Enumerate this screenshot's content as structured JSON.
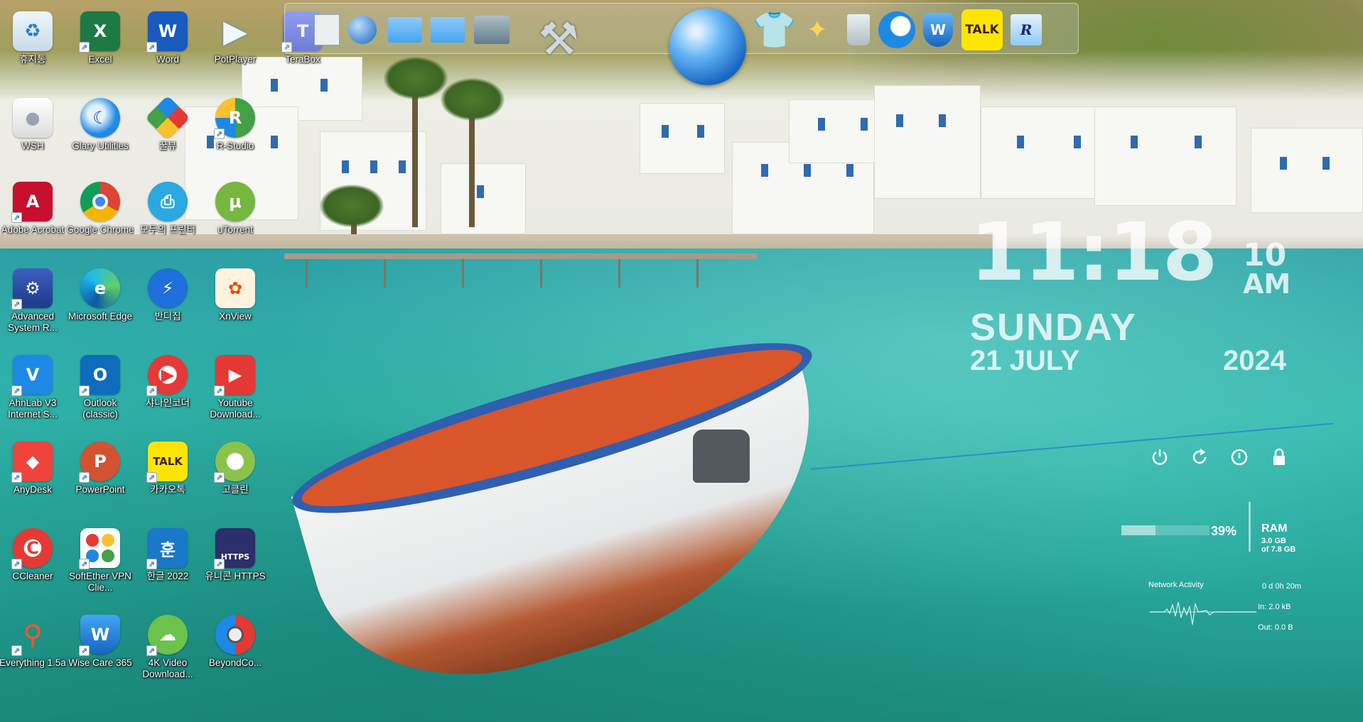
{
  "desktop": {
    "icons": [
      {
        "label": "휴지통"
      },
      {
        "label": "Excel"
      },
      {
        "label": "Word"
      },
      {
        "label": "PotPlayer"
      },
      {
        "label": "TeraBox"
      },
      {
        "label": "WSH"
      },
      {
        "label": "Glary Utilities"
      },
      {
        "label": "꿀뷰"
      },
      {
        "label": "R-Studio"
      },
      {
        "label": "Adobe Acrobat"
      },
      {
        "label": "Google Chrome"
      },
      {
        "label": "모두의 프린터"
      },
      {
        "label": "uTorrent"
      },
      {
        "label": "Advanced System R..."
      },
      {
        "label": "Microsoft Edge"
      },
      {
        "label": "반디집"
      },
      {
        "label": "XnView"
      },
      {
        "label": "AhnLab V3 Internet S..."
      },
      {
        "label": "Outlook (classic)"
      },
      {
        "label": "샤나인코더"
      },
      {
        "label": "Youtube Download..."
      },
      {
        "label": "AnyDesk"
      },
      {
        "label": "PowerPoint"
      },
      {
        "label": "카카오톡"
      },
      {
        "label": "고클린"
      },
      {
        "label": "CCleaner"
      },
      {
        "label": "SoftEther VPN Clie..."
      },
      {
        "label": "한글 2022"
      },
      {
        "label": "유니콘 HTTPS"
      },
      {
        "label": "Everything 1.5a"
      },
      {
        "label": "Wise Care 365"
      },
      {
        "label": "4K Video Download..."
      },
      {
        "label": "BeyondCo..."
      }
    ],
    "icon_glyphs": {
      "excel": "X",
      "word": "W",
      "acrobat": "A",
      "outlook": "O",
      "anydesk": "◆",
      "powerpoint": "P",
      "kakao": "TALK",
      "hangul": "훈",
      "https": "HTTPS",
      "xnview": "✿",
      "utorrent": "μ",
      "bandizip": "⚡",
      "glary": "☾",
      "everything": "🔍",
      "ccleaner": "C",
      "wsh": "●",
      "youtube": "▶"
    }
  },
  "dock": {
    "kakao_label": "TALK",
    "reg_label": "R"
  },
  "clock": {
    "time": "11:18",
    "seconds": "10",
    "ampm": "AM",
    "day": "SUNDAY",
    "date": "21 JULY",
    "year": "2024"
  },
  "system": {
    "ram_percent": "39%",
    "ram_fraction": 0.39,
    "ram_title": "RAM",
    "ram_used": "3.0 GB",
    "ram_total": "of 7.8 GB",
    "network_title": "Network Activity",
    "uptime": "0 d 0h 20m",
    "net_in": "In: 2.0 kB",
    "net_out": "Out: 0.0 B"
  },
  "colors": {
    "sea": "#2fb3b0",
    "widget_text": "#ffffff",
    "boat_blue": "#2f5fb0"
  }
}
